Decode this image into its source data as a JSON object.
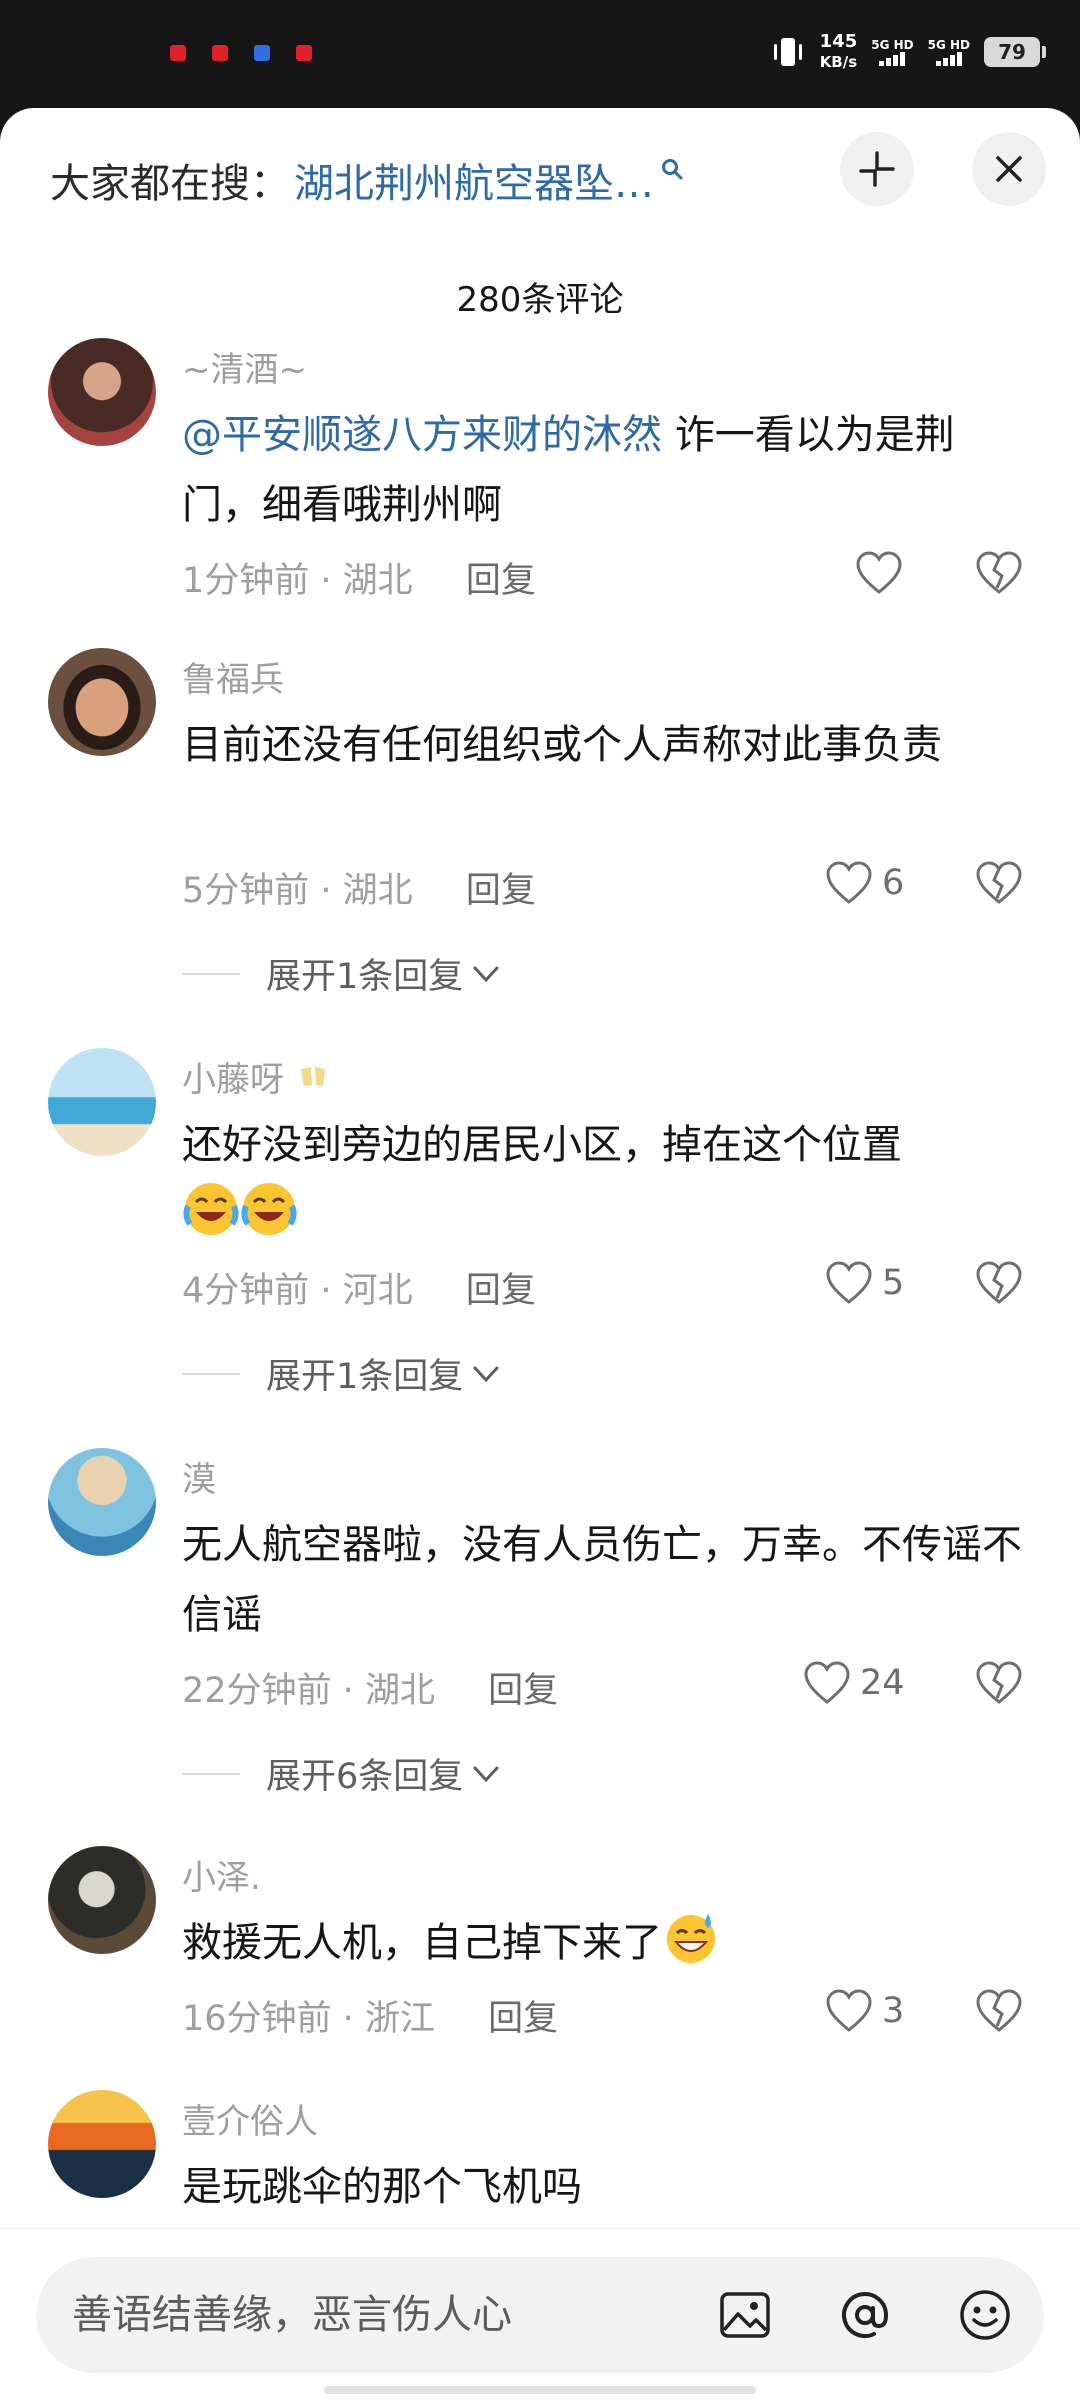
{
  "status_bar": {
    "speed_value": "145",
    "speed_unit": "KB/s",
    "net1": "5G HD",
    "net2": "5G HD",
    "battery": "79",
    "icons": [
      "red-notification-dot",
      "red-notification-dot",
      "blue-notification-dot",
      "red-notification-dot",
      "vibrate-icon",
      "signal-icon",
      "battery-icon"
    ],
    "dot_colors": [
      "#e0202a",
      "#e0202a",
      "#2f6fe0",
      "#e0202a"
    ]
  },
  "header": {
    "search_prefix": "大家都在搜：",
    "search_term": "湖北荆州航空器坠…",
    "search_icon": "search-icon",
    "collapse_icon": "collapse-icon",
    "close_icon": "close-icon"
  },
  "comment_count": "280条评论",
  "comments": [
    {
      "username": "~清酒~",
      "mention": "@平安顺遂八方来财的沐然",
      "text": " 诈一看以为是荆门，细看哦荆州啊",
      "time": "1分钟前",
      "location": "湖北",
      "reply_label": "回复",
      "likes": ""
    },
    {
      "username": "鲁福兵",
      "text": "目前还没有任何组织或个人声称对此事负责",
      "time": "5分钟前",
      "location": "湖北",
      "reply_label": "回复",
      "likes": "6",
      "expand_label": "展开1条回复"
    },
    {
      "username": "小藤呀",
      "text": "还好没到旁边的居民小区，掉在这个位置",
      "emoji_icons": [
        "crying-laughing-emoji",
        "crying-laughing-emoji"
      ],
      "time": "4分钟前",
      "location": "河北",
      "reply_label": "回复",
      "likes": "5",
      "expand_label": "展开1条回复"
    },
    {
      "username": "漠",
      "text": "无人航空器啦，没有人员伤亡，万幸。不传谣不信谣",
      "time": "22分钟前",
      "location": "湖北",
      "reply_label": "回复",
      "likes": "24",
      "expand_label": "展开6条回复"
    },
    {
      "username": "小泽.",
      "text": "救援无人机，自己掉下来了",
      "emoji_icons": [
        "sweat-smile-emoji"
      ],
      "time": "16分钟前",
      "location": "浙江",
      "reply_label": "回复",
      "likes": "3"
    },
    {
      "username": "壹介俗人",
      "text": "是玩跳伞的那个飞机吗"
    }
  ],
  "input_bar": {
    "placeholder": "善语结善缘，恶言伤人心",
    "icons": [
      "image-icon",
      "at-icon",
      "emoji-icon"
    ]
  }
}
